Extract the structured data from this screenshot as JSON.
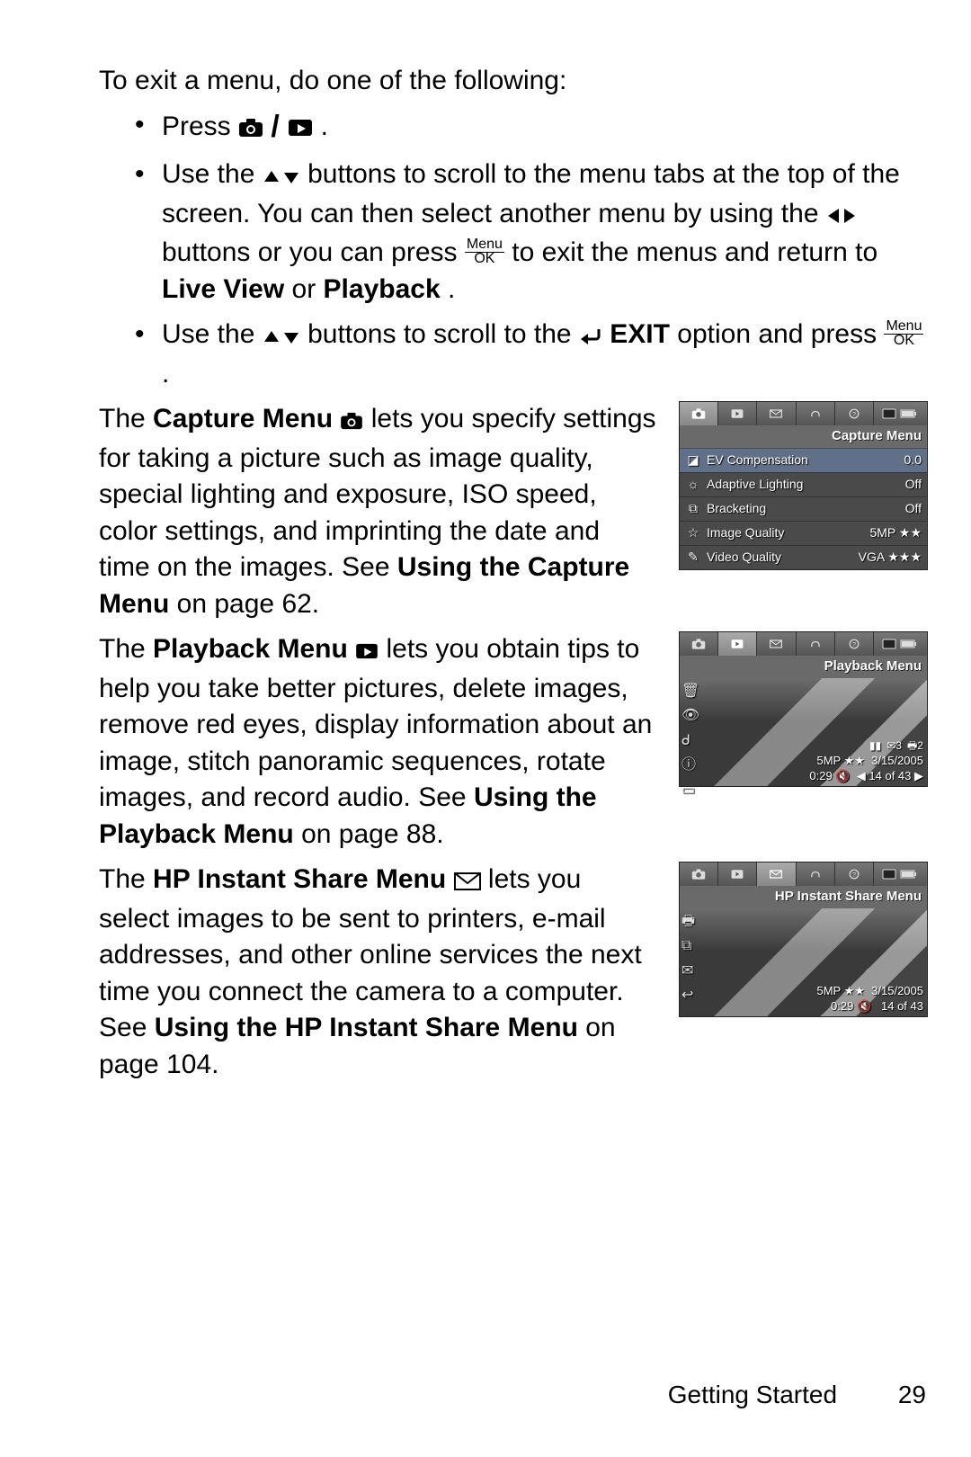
{
  "intro": "To exit a menu, do one of the following:",
  "bullets": {
    "b1_prefix": "Press ",
    "b1_suffix": ".",
    "b2_prefix": "Use the ",
    "b2_mid1": " buttons to scroll to the menu tabs at the top of the screen. You can then select another menu by using the ",
    "b2_mid2": " buttons or you can press ",
    "b2_mid3": " to exit the menus and return to ",
    "b2_bold1": "Live View",
    "b2_or": " or ",
    "b2_bold2": "Playback",
    "b2_end": ".",
    "b3_prefix": "Use the ",
    "b3_mid1": " buttons to scroll to the ",
    "b3_bold": "EXIT",
    "b3_mid2": " option and press ",
    "b3_end": "."
  },
  "menu_ok": {
    "top": "Menu",
    "bot": "OK"
  },
  "capture": {
    "pre": "The ",
    "title": "Capture Menu",
    "post": " lets you specify settings for taking a picture such as image quality, special lighting and exposure, ISO speed, color settings, and imprinting the date and time on the images. See ",
    "link": "Using the Capture Menu",
    "tail": " on page 62.",
    "screen_title": "Capture Menu",
    "items": [
      {
        "icon": "◪",
        "label": "EV Compensation",
        "value": "0.0"
      },
      {
        "icon": "☼",
        "label": "Adaptive Lighting",
        "value": "Off"
      },
      {
        "icon": "⧉",
        "label": "Bracketing",
        "value": "Off"
      },
      {
        "icon": "☆",
        "label": "Image Quality",
        "value": "5MP ★★"
      },
      {
        "icon": "✎",
        "label": "Video Quality",
        "value": "VGA ★★★"
      }
    ]
  },
  "playback": {
    "pre": "The ",
    "title": "Playback Menu",
    "post": " lets you obtain tips to help you take better pictures, delete images, remove red eyes, display information about an image, stitch panoramic sequences, rotate images, and record audio. See ",
    "link": "Using the Playback Menu",
    "tail": " on page 88.",
    "screen_title": "Playback Menu",
    "side_icons": [
      "🗑",
      "👁",
      "ᑯ",
      "ⓘ",
      "▭"
    ],
    "envelope_count": "✉3",
    "print_count": "🖶2",
    "quality": "5MP ★★",
    "date": "3/15/2005",
    "time": "0:29",
    "sound": "🔇",
    "index": "◀ 14 of 43 ▶"
  },
  "share": {
    "pre": "The ",
    "title": "HP Instant Share Menu",
    "post": " lets you select images to be sent to printers, e-mail addresses, and other online services the next time you connect the camera to a computer. See ",
    "link": "Using the HP Instant Share Menu",
    "tail": " on page 104.",
    "screen_title": "HP Instant Share Menu",
    "side_icons": [
      "🖶",
      "⧉",
      "✉",
      "↩"
    ],
    "quality": "5MP ★★",
    "date": "3/15/2005",
    "time": "0:29",
    "sound": "🔇",
    "index": "14 of 43"
  },
  "footer": {
    "section": "Getting Started",
    "page": "29"
  }
}
